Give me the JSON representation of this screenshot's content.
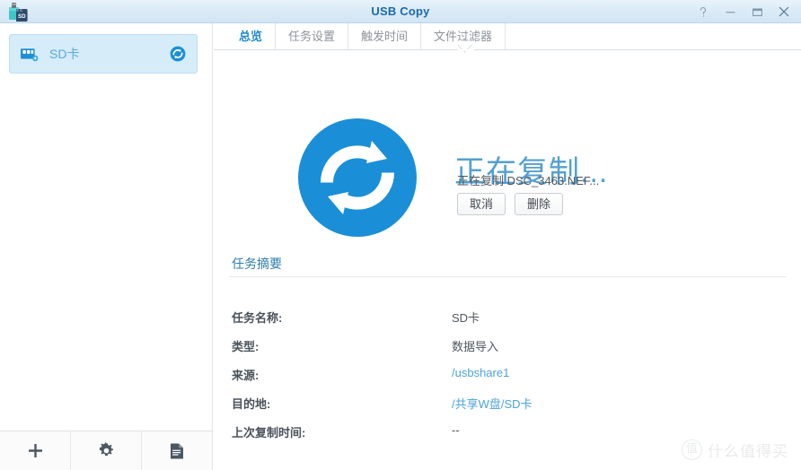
{
  "window": {
    "title": "USB Copy",
    "app_icon": "usb-sd-card-icon",
    "controls": {
      "help": "?",
      "minimize": "—",
      "maximize": "□",
      "close": "✕"
    }
  },
  "sidebar": {
    "tasks": [
      {
        "label": "SD卡",
        "icon": "sd-card-icon",
        "status_icon": "sync-running-icon",
        "selected": true
      }
    ],
    "toolbar": [
      {
        "name": "add-task-button",
        "icon": "plus-icon"
      },
      {
        "name": "settings-button",
        "icon": "gear-icon"
      },
      {
        "name": "log-button",
        "icon": "document-log-icon"
      }
    ]
  },
  "main": {
    "tabs": [
      {
        "label": "总览",
        "active": true
      },
      {
        "label": "任务设置",
        "active": false
      },
      {
        "label": "触发时间",
        "active": false
      },
      {
        "label": "文件过滤器",
        "active": false
      }
    ],
    "status": {
      "icon": "sync-circle-icon",
      "title": "正在复制...",
      "detail": "正在复制 DSC_3463.NEF...",
      "buttons": [
        {
          "label": "取消",
          "name": "cancel-button"
        },
        {
          "label": "删除",
          "name": "delete-button"
        }
      ]
    },
    "summary": {
      "heading": "任务摘要",
      "rows": [
        {
          "label": "任务名称:",
          "value": "SD卡",
          "link": false
        },
        {
          "label": "类型:",
          "value": "数据导入",
          "link": false
        },
        {
          "label": "来源:",
          "value": "/usbshare1",
          "link": true
        },
        {
          "label": "目的地:",
          "value": "/共享W盘/SD卡",
          "link": true
        },
        {
          "label": "上次复制时间:",
          "value": "--",
          "link": false
        }
      ]
    }
  },
  "watermark": {
    "badge": "值",
    "text": "什么值得买"
  },
  "colors": {
    "accent_blue": "#1a6aab",
    "tab_active": "#2189cd",
    "sync_blue": "#1a8fd8",
    "hero_title": "#54a0cf",
    "link": "#4da3dd",
    "sidebar_selected_bg": "#d6ecf9"
  }
}
